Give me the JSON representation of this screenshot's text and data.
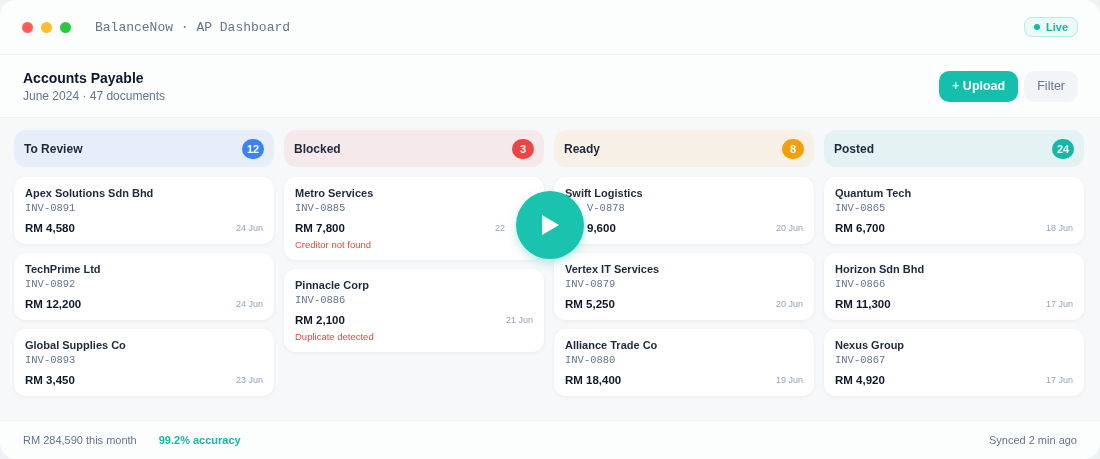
{
  "window": {
    "title": "BalanceNow · AP Dashboard",
    "status": "Live"
  },
  "header": {
    "title": "Accounts Payable",
    "subtitle": "June 2024 · 47 documents",
    "buttons": [
      {
        "label": "+ Upload",
        "kind": "primary"
      },
      {
        "label": "Filter",
        "kind": "secondary"
      }
    ]
  },
  "columns": [
    {
      "title": "To Review",
      "count": "12",
      "color": "#3b82f6",
      "cards": [
        {
          "kind": "plain",
          "vendor": "Apex Solutions Sdn Bhd",
          "invoice": "INV-0891",
          "amount": "RM 4,580",
          "date": "24 Jun"
        },
        {
          "kind": "plain",
          "vendor": "TechPrime Ltd",
          "invoice": "INV-0892",
          "amount": "RM 12,200",
          "date": "24 Jun"
        },
        {
          "kind": "plain",
          "vendor": "Global Supplies Co",
          "invoice": "INV-0893",
          "amount": "RM 3,450",
          "date": "23 Jun"
        }
      ]
    },
    {
      "title": "Blocked",
      "count": "3",
      "color": "#ef4444",
      "cards": [
        {
          "kind": "overlapped_right",
          "vendor": "Metro Services",
          "invoice": "INV-0885",
          "amount": "RM 7,800",
          "date": "22",
          "issue": "Creditor not found"
        },
        {
          "kind": "plain",
          "vendor": "Pinnacle Corp",
          "invoice": "INV-0886",
          "amount": "RM 2,100",
          "date": "21 Jun",
          "issue": "Duplicate detected"
        }
      ]
    },
    {
      "title": "Ready",
      "count": "8",
      "color": "#f59e0b",
      "cards": [
        {
          "kind": "overlapped_left",
          "vendor": "Swift Logistics",
          "invoice": "V-0878",
          "amount": "9,600",
          "date": "20 Jun"
        },
        {
          "kind": "plain",
          "vendor": "Vertex IT Services",
          "invoice": "INV-0879",
          "amount": "RM 5,250",
          "date": "20 Jun"
        },
        {
          "kind": "plain",
          "vendor": "Alliance Trade Co",
          "invoice": "INV-0880",
          "amount": "RM 18,400",
          "date": "19 Jun"
        }
      ]
    },
    {
      "title": "Posted",
      "count": "24",
      "color": "#14b8a6",
      "cards": [
        {
          "kind": "plain",
          "vendor": "Quantum Tech",
          "invoice": "INV-0865",
          "amount": "RM 6,700",
          "date": "18 Jun"
        },
        {
          "kind": "plain",
          "vendor": "Horizon Sdn Bhd",
          "invoice": "INV-0866",
          "amount": "RM 11,300",
          "date": "17 Jun"
        },
        {
          "kind": "plain",
          "vendor": "Nexus Group",
          "invoice": "INV-0867",
          "amount": "RM 4,920",
          "date": "17 Jun"
        }
      ]
    }
  ],
  "status_bar": {
    "total": "RM 284,590 this month",
    "accuracy": "99.2% accuracy",
    "synced": "Synced 2 min ago"
  }
}
